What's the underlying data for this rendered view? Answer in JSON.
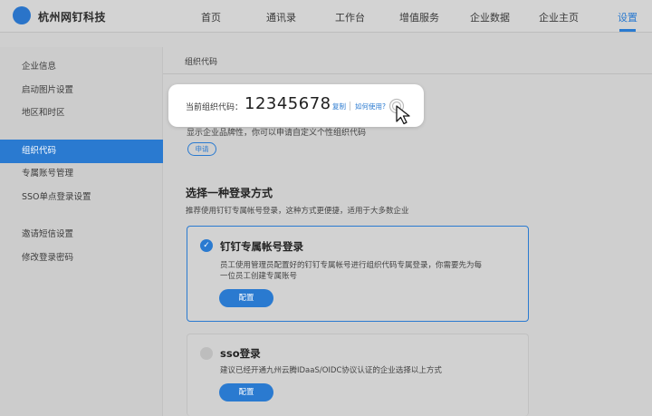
{
  "app": {
    "brand": "杭州网钉科技"
  },
  "nav": {
    "items": [
      "首页",
      "通讯录",
      "工作台",
      "增值服务",
      "企业数据",
      "企业主页",
      "设置"
    ],
    "active": "设置"
  },
  "sidebar": {
    "items": [
      "企业信息",
      "启动图片设置",
      "地区和时区",
      "组织代码",
      "专属账号管理",
      "SSO单点登录设置",
      "邀请短信设置",
      "修改登录密码"
    ],
    "active": "组织代码"
  },
  "main": {
    "title": "组织代码",
    "current_label": "当前组织代码：",
    "current_code": "12345678",
    "copy_label": "复制",
    "howto_label": "如何使用?",
    "desc": "显示企业品牌性，你可以申请自定义个性组织代码",
    "apply_label": "申请",
    "section_title": "选择一种登录方式",
    "section_sub": "推荐使用钉钉专属帐号登录，这种方式更便捷，适用于大多数企业",
    "options": [
      {
        "title": "钉钉专属帐号登录",
        "desc_line1": "员工使用管理员配置好的钉钉专属帐号进行组织代码专属登录，你需要先为每",
        "desc_line2": "一位员工创建专属账号",
        "button": "配置",
        "selected": true
      },
      {
        "title": "sso登录",
        "desc_line1": "建议已经开通九州云腾IDaaS/OIDC协议认证的企业选择以上方式",
        "button": "配置",
        "selected": false
      }
    ]
  },
  "icons": {
    "logo": "company-logo",
    "check": "check-icon",
    "cursor": "pointer-cursor-icon"
  },
  "colors": {
    "accent": "#2a7ad0"
  }
}
